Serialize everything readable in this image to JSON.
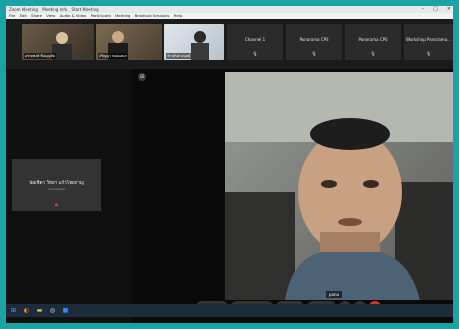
{
  "window": {
    "title": "Zoom Meeting",
    "title2": "Meeting Info",
    "title3": "Start Meeting"
  },
  "menu": [
    "File",
    "Edit",
    "Share",
    "View",
    "Audio & Video",
    "Participant",
    "Meeting",
    "Breakout Sessions",
    "Help"
  ],
  "thumbnails": [
    {
      "name": "อรรถพงษ์ ชินบุญชัย"
    },
    {
      "name": "ปริญญา หอมเอนก"
    },
    {
      "name": "จักรพันธ์ มนุษย์"
    }
  ],
  "channels": [
    "Channel 1",
    "Panorama CPS",
    "Panorama CPS",
    "Workshop Panorama..."
  ],
  "left_tile": {
    "name": "นัยเชิดา วิทยา แก้วไชยกาญ",
    "sub": "Connected"
  },
  "video": {
    "name": "panu"
  },
  "controls": {
    "mute": "Mute",
    "stop_video": "Stop video",
    "share": "Share",
    "record": "Record"
  },
  "colors": {
    "desktop": "#1aa3a3",
    "end": "#d9362b"
  }
}
